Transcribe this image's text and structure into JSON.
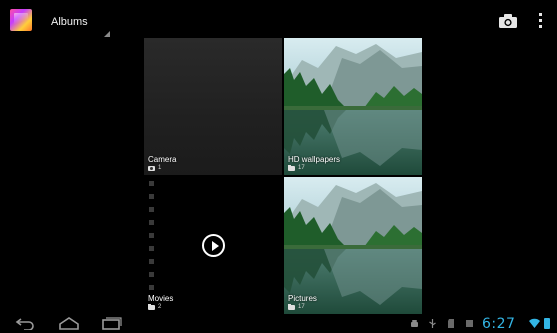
{
  "action_bar": {
    "title": "Albums",
    "app_icon": "gallery-app-icon",
    "actions": [
      {
        "name": "camera",
        "icon": "camera-icon"
      },
      {
        "name": "overflow-menu",
        "icon": "more-vert-icon"
      }
    ]
  },
  "albums": [
    {
      "name": "Camera",
      "count": "1",
      "count_icon": "camera-icon"
    },
    {
      "name": "HD wallpapers",
      "count": "17",
      "count_icon": "folder-icon"
    },
    {
      "name": "Movies",
      "count": "2",
      "count_icon": "folder-icon"
    },
    {
      "name": "Pictures",
      "count": "17",
      "count_icon": "folder-icon"
    }
  ],
  "system_bar": {
    "time": "6:27",
    "accent": "#33b5e5",
    "nav_icons": [
      "back-icon",
      "home-icon",
      "recent-apps-icon"
    ],
    "status_icons": [
      "android-debug-icon",
      "usb-icon",
      "sd-card-icon",
      "screenshot-icon",
      "wifi-icon",
      "battery-icon"
    ]
  }
}
